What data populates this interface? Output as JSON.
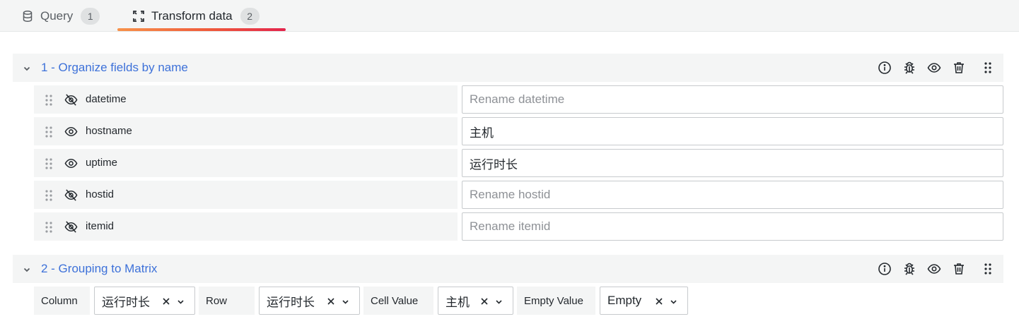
{
  "tabs": [
    {
      "label": "Query",
      "count": "1",
      "icon": "database-icon",
      "active": false
    },
    {
      "label": "Transform data",
      "count": "2",
      "icon": "transform-icon",
      "active": true
    }
  ],
  "accent": {
    "link_blue": "#3d71d9",
    "tab_underline_from": "#f7924a",
    "tab_underline_to": "#e3244c"
  },
  "transformations": [
    {
      "title": "1 - Organize fields by name",
      "header_icons": [
        "info-icon",
        "bug-icon",
        "eye-icon",
        "trash-icon",
        "drag-icon"
      ],
      "fields": [
        {
          "name": "datetime",
          "visible": false,
          "value": "",
          "placeholder": "Rename datetime"
        },
        {
          "name": "hostname",
          "visible": true,
          "value": "主机",
          "placeholder": "Rename hostname"
        },
        {
          "name": "uptime",
          "visible": true,
          "value": "运行时长",
          "placeholder": "Rename uptime"
        },
        {
          "name": "hostid",
          "visible": false,
          "value": "",
          "placeholder": "Rename hostid"
        },
        {
          "name": "itemid",
          "visible": false,
          "value": "",
          "placeholder": "Rename itemid"
        }
      ]
    },
    {
      "title": "2 - Grouping to Matrix",
      "header_icons": [
        "info-icon",
        "bug-icon",
        "eye-icon",
        "trash-icon",
        "drag-icon"
      ],
      "options": [
        {
          "label": "Column",
          "value": "运行时长"
        },
        {
          "label": "Row",
          "value": "运行时长"
        },
        {
          "label": "Cell Value",
          "value": "主机"
        },
        {
          "label": "Empty Value",
          "value": "Empty"
        }
      ]
    }
  ]
}
